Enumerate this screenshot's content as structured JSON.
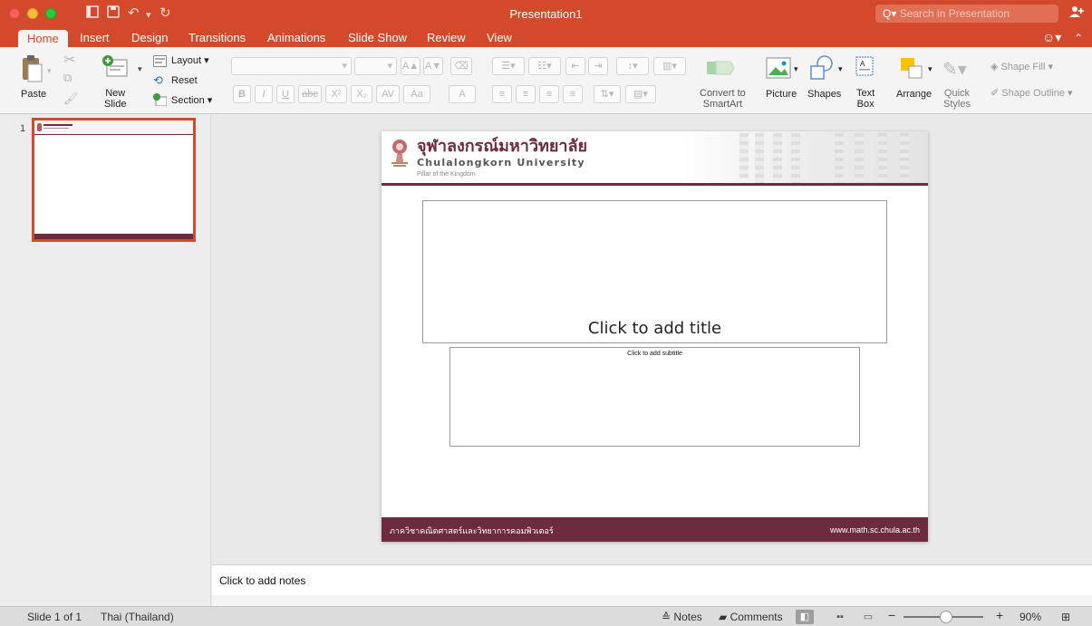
{
  "window": {
    "title": "Presentation1",
    "search_placeholder": "Search in Presentation"
  },
  "ribbon_tabs": [
    "Home",
    "Insert",
    "Design",
    "Transitions",
    "Animations",
    "Slide Show",
    "Review",
    "View"
  ],
  "ribbon": {
    "paste": "Paste",
    "new_slide": "New\nSlide",
    "layout": "Layout",
    "reset": "Reset",
    "section": "Section",
    "convert_smartart": "Convert to\nSmartArt",
    "picture": "Picture",
    "shapes": "Shapes",
    "text_box": "Text\nBox",
    "arrange": "Arrange",
    "quick_styles": "Quick\nStyles",
    "shape_fill": "Shape Fill",
    "shape_outline": "Shape Outline",
    "fmt": {
      "bold": "B",
      "italic": "I",
      "underline": "U",
      "strike": "abc",
      "superscript": "X²",
      "subscript": "X₂",
      "spacing": "AV",
      "case": "Aa",
      "font_color": "A",
      "grow": "A▲",
      "shrink": "A▼"
    }
  },
  "thumbnails": [
    {
      "number": "1"
    }
  ],
  "slide": {
    "header_thai": "จุฬาลงกรณ์มหาวิทยาลัย",
    "header_english": "Chulalongkorn University",
    "motto": "Pillar of the Kingdom",
    "title_placeholder": "Click to add title",
    "subtitle_placeholder": "Click to add subtitle",
    "footer_left": "ภาควิชาคณิตศาสตร์และวิทยาการคอมพิวเตอร์",
    "footer_right": "www.math.sc.chula.ac.th"
  },
  "notes_placeholder": "Click to add notes",
  "status": {
    "slide_counter": "Slide 1 of 1",
    "language": "Thai (Thailand)",
    "notes": "Notes",
    "comments": "Comments",
    "zoom": "90%",
    "zoom_level": 0.53
  },
  "colors": {
    "accent": "#d3492c",
    "slide_brand": "#6e2a3f"
  }
}
